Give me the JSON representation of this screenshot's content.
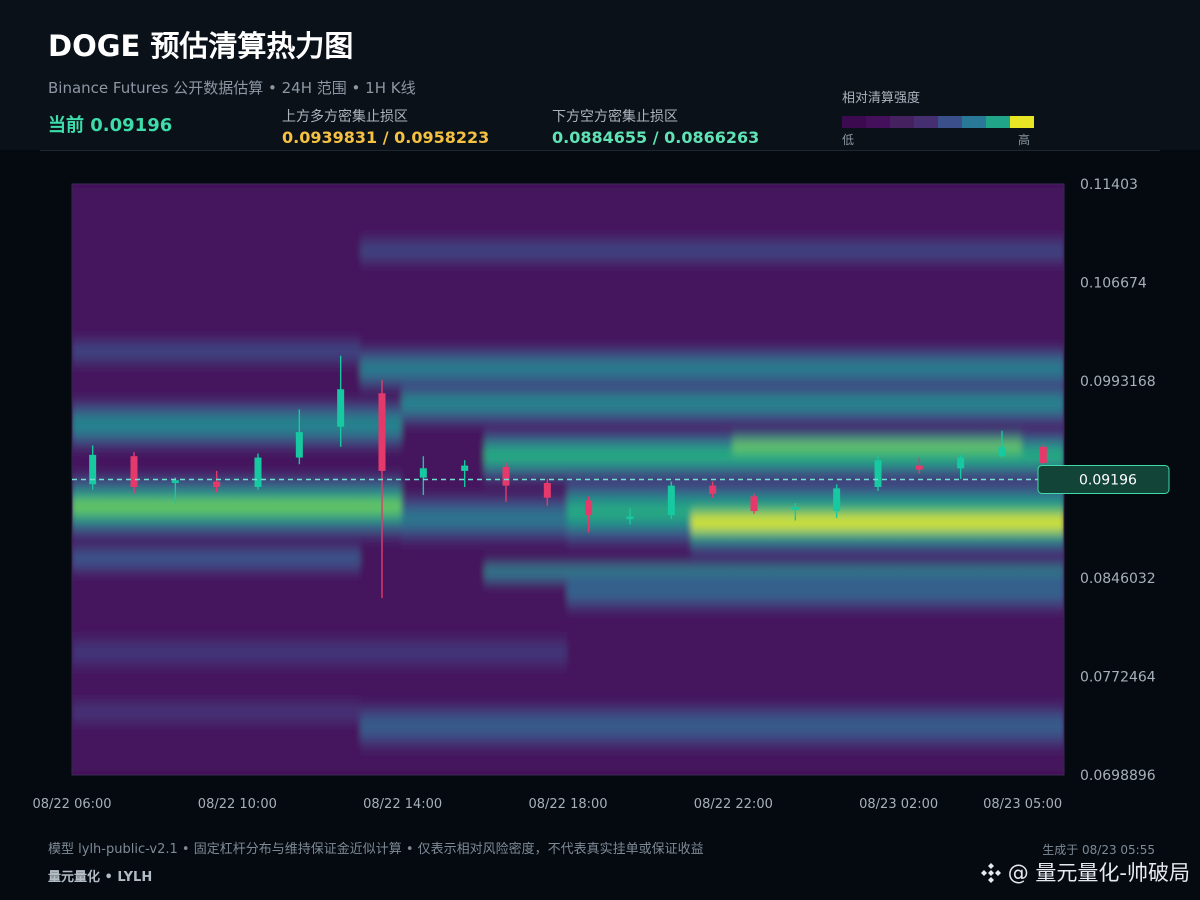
{
  "header": {
    "title": "DOGE 预估清算热力图",
    "subtitle": "Binance Futures 公开数据估算 • 24H 范围 • 1H K线",
    "current_price_label": "当前 0.09196",
    "upper_zone_label": "上方多方密集止损区",
    "upper_zone_value": "0.0939831 / 0.0958223",
    "lower_zone_label": "下方空方密集止损区",
    "lower_zone_value": "0.0884655 / 0.0866263"
  },
  "legend": {
    "title": "相对清算强度",
    "low_label": "低",
    "high_label": "高",
    "colors": [
      "#3b0a4f",
      "#440f5b",
      "#46215f",
      "#462f71",
      "#3b4f8a",
      "#2a7898",
      "#21a589",
      "#e8e624"
    ]
  },
  "colors": {
    "bullish": "#17c9a0",
    "bearish": "#e6396b",
    "current_line": "#6fe0cf",
    "price_tag_bg": "#124437",
    "price_tag_border": "#3ddcaa"
  },
  "chart_data": {
    "type": "heatmap",
    "xlabels": [
      "08/22 06:00",
      "08/22 10:00",
      "08/22 14:00",
      "08/22 18:00",
      "08/22 22:00",
      "08/23 02:00",
      "08/23 05:00"
    ],
    "xlabel_hours": [
      0,
      4,
      8,
      12,
      16,
      20,
      23
    ],
    "x_range_hours": [
      0,
      24
    ],
    "y_ticks": [
      "0.11403",
      "0.106674",
      "0.0993168",
      "0.09196",
      "0.0846032",
      "0.0772464",
      "0.0698896"
    ],
    "ylim": [
      0.0698896,
      0.11403
    ],
    "current_price": 0.09196,
    "current_price_tag": "0.09196",
    "candles": [
      {
        "t": 0.5,
        "o": 0.0916,
        "c": 0.0938,
        "h": 0.0945,
        "l": 0.0912
      },
      {
        "t": 1.5,
        "o": 0.0937,
        "c": 0.0914,
        "h": 0.094,
        "l": 0.0909
      },
      {
        "t": 2.5,
        "o": 0.0917,
        "c": 0.0919,
        "h": 0.0921,
        "l": 0.0902
      },
      {
        "t": 3.5,
        "o": 0.0918,
        "c": 0.0914,
        "h": 0.0926,
        "l": 0.091
      },
      {
        "t": 4.5,
        "o": 0.0914,
        "c": 0.0936,
        "h": 0.0939,
        "l": 0.0912
      },
      {
        "t": 5.5,
        "o": 0.0936,
        "c": 0.0955,
        "h": 0.0972,
        "l": 0.0931
      },
      {
        "t": 6.5,
        "o": 0.0959,
        "c": 0.0987,
        "h": 0.1012,
        "l": 0.0944
      },
      {
        "t": 7.5,
        "o": 0.0984,
        "c": 0.0926,
        "h": 0.0994,
        "l": 0.0831
      },
      {
        "t": 8.5,
        "o": 0.0921,
        "c": 0.0928,
        "h": 0.0937,
        "l": 0.0908
      },
      {
        "t": 9.5,
        "o": 0.0926,
        "c": 0.093,
        "h": 0.0934,
        "l": 0.0914
      },
      {
        "t": 10.5,
        "o": 0.0929,
        "c": 0.0915,
        "h": 0.0932,
        "l": 0.0903
      },
      {
        "t": 11.5,
        "o": 0.0917,
        "c": 0.0906,
        "h": 0.092,
        "l": 0.09
      },
      {
        "t": 12.5,
        "o": 0.0904,
        "c": 0.0893,
        "h": 0.0907,
        "l": 0.088
      },
      {
        "t": 13.5,
        "o": 0.089,
        "c": 0.0892,
        "h": 0.0898,
        "l": 0.0886
      },
      {
        "t": 14.5,
        "o": 0.0893,
        "c": 0.0915,
        "h": 0.0918,
        "l": 0.089
      },
      {
        "t": 15.5,
        "o": 0.0915,
        "c": 0.0909,
        "h": 0.0918,
        "l": 0.0906
      },
      {
        "t": 16.5,
        "o": 0.0907,
        "c": 0.0896,
        "h": 0.0909,
        "l": 0.0894
      },
      {
        "t": 17.5,
        "o": 0.0897,
        "c": 0.0899,
        "h": 0.0902,
        "l": 0.0889
      },
      {
        "t": 18.5,
        "o": 0.0896,
        "c": 0.0913,
        "h": 0.0916,
        "l": 0.0891
      },
      {
        "t": 19.5,
        "o": 0.0914,
        "c": 0.0934,
        "h": 0.0937,
        "l": 0.0911
      },
      {
        "t": 20.5,
        "o": 0.093,
        "c": 0.0927,
        "h": 0.0936,
        "l": 0.0924
      },
      {
        "t": 21.5,
        "o": 0.0928,
        "c": 0.0936,
        "h": 0.0938,
        "l": 0.092
      },
      {
        "t": 22.5,
        "o": 0.0937,
        "c": 0.0944,
        "h": 0.0956,
        "l": 0.0936
      },
      {
        "t": 23.5,
        "o": 0.0944,
        "c": 0.0932,
        "h": 0.0946,
        "l": 0.0928
      }
    ],
    "bands": [
      {
        "center": 0.085,
        "width": 0.0004,
        "t0": 10.0,
        "t1": 24,
        "level": 0.62
      },
      {
        "center": 0.0895,
        "width": 0.0012,
        "t0": 12.2,
        "t1": 24,
        "level": 0.78
      },
      {
        "center": 0.0887,
        "width": 0.0011,
        "t0": 15.0,
        "t1": 24,
        "level": 1.0
      },
      {
        "center": 0.0899,
        "width": 0.0011,
        "t0": 0,
        "t1": 7.8,
        "level": 0.88
      },
      {
        "center": 0.089,
        "width": 0.0009,
        "t0": 8.0,
        "t1": 12.5,
        "level": 0.55
      },
      {
        "center": 0.0937,
        "width": 0.0009,
        "t0": 10.0,
        "t1": 24,
        "level": 0.8
      },
      {
        "center": 0.0943,
        "width": 0.0006,
        "t0": 16.0,
        "t1": 23.0,
        "level": 0.9
      },
      {
        "center": 0.096,
        "width": 0.0009,
        "t0": 0,
        "t1": 8.0,
        "level": 0.62
      },
      {
        "center": 0.0976,
        "width": 0.0008,
        "t0": 8.0,
        "t1": 24,
        "level": 0.62
      },
      {
        "center": 0.1002,
        "width": 0.0008,
        "t0": 6.7,
        "t1": 24,
        "level": 0.58
      },
      {
        "center": 0.1015,
        "width": 0.0006,
        "t0": 0,
        "t1": 6.5,
        "level": 0.32
      },
      {
        "center": 0.109,
        "width": 0.0006,
        "t0": 6.7,
        "t1": 24,
        "level": 0.32
      },
      {
        "center": 0.0836,
        "width": 0.0008,
        "t0": 12.0,
        "t1": 24,
        "level": 0.46
      },
      {
        "center": 0.086,
        "width": 0.0006,
        "t0": 0,
        "t1": 7.0,
        "level": 0.4
      },
      {
        "center": 0.079,
        "width": 0.0008,
        "t0": 0,
        "t1": 12.0,
        "level": 0.25
      },
      {
        "center": 0.0735,
        "width": 0.0009,
        "t0": 7.0,
        "t1": 24,
        "level": 0.42
      },
      {
        "center": 0.0745,
        "width": 0.0006,
        "t0": 0,
        "t1": 7.0,
        "level": 0.25
      }
    ]
  },
  "footer": {
    "note": "模型 lylh-public-v2.1 • 固定杠杆分布与维持保证金近似计算 • 仅表示相对风险密度，不代表真实挂单或保证收益",
    "brand": "量元量化 • LYLH",
    "generated": "生成于 08/23 05:55",
    "watermark": "@ 量元量化-帅破局"
  }
}
